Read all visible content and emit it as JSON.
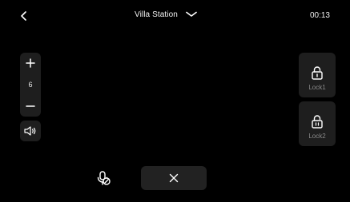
{
  "header": {
    "title": "Villa Station",
    "time": "00:13",
    "back_icon": "chevron-left-icon",
    "dropdown_icon": "chevron-down-icon"
  },
  "zoom": {
    "value": "6",
    "plus_icon": "plus-icon",
    "minus_icon": "minus-icon"
  },
  "speaker": {
    "icon": "speaker-icon"
  },
  "locks": [
    {
      "label": "Lock1",
      "icon": "lock-icon"
    },
    {
      "label": "Lock2",
      "icon": "lock-icon"
    }
  ],
  "controls": {
    "mic_icon": "mic-muted-icon",
    "hangup_icon": "close-icon"
  },
  "colors": {
    "background": "#000000",
    "panel": "#1e1e1e",
    "text": "#f2f2f2",
    "muted_text": "#8a8a8a"
  }
}
